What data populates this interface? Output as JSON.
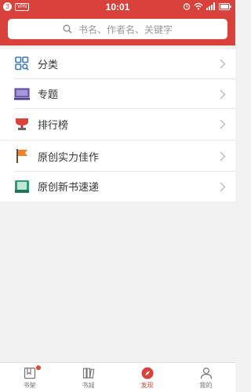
{
  "status_bar": {
    "sim_badge": "3",
    "vpn_badge": "VPN",
    "time": "10:01"
  },
  "search": {
    "placeholder": "书名、作者名、关键字"
  },
  "menu": {
    "group1": [
      {
        "label": "分类",
        "icon": "grid-search-icon"
      },
      {
        "label": "专题",
        "icon": "monitor-icon"
      },
      {
        "label": "排行榜",
        "icon": "trophy-icon"
      }
    ],
    "group2": [
      {
        "label": "原创实力佳作",
        "icon": "flag-icon"
      },
      {
        "label": "原创新书速递",
        "icon": "book-new-icon"
      }
    ]
  },
  "bottom_nav": {
    "items": [
      {
        "label": "书架",
        "icon": "bookshelf-icon",
        "has_badge": true
      },
      {
        "label": "书城",
        "icon": "bookstore-icon"
      },
      {
        "label": "发现",
        "icon": "compass-icon",
        "active": true
      },
      {
        "label": "我的",
        "icon": "person-icon"
      }
    ]
  },
  "colors": {
    "brand_red": "#d8423a",
    "background": "#f2f2f2"
  }
}
